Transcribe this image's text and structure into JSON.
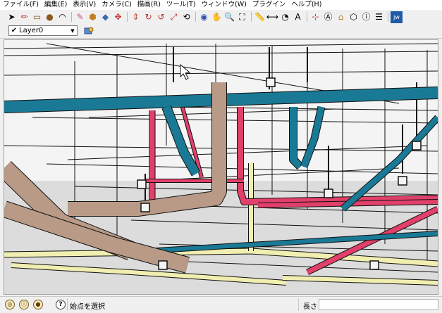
{
  "menu": [
    "ファイル(F)",
    "編集(E)",
    "表示(V)",
    "カメラ(C)",
    "描画(R)",
    "ツール(T)",
    "ウィンドウ(W)",
    "プラグイン",
    "ヘルプ(H)"
  ],
  "toolbar": {
    "icons": [
      "select-icon",
      "pencil-icon",
      "rectangle-icon",
      "circle-icon",
      "arc-icon",
      "eraser-icon",
      "paint-bucket-icon",
      "component-icon",
      "move-icon",
      "push-pull-icon",
      "rotate-icon",
      "follow-me-icon",
      "scale-icon",
      "offset-icon",
      "orbit-icon",
      "pan-icon",
      "zoom-icon",
      "zoom-extents-icon",
      "tape-measure-icon",
      "dimension-icon",
      "protractor-icon",
      "text-icon",
      "axes-icon",
      "3d-text-icon",
      "warehouse-icon",
      "extension-icon",
      "model-info-icon",
      "layer-icon",
      "plugin-icon"
    ],
    "glyphs": [
      "➤",
      "✏",
      "▭",
      "●",
      "◠",
      "✎",
      "⬢",
      "◆",
      "✥",
      "⇕",
      "↻",
      "↺",
      "⤢",
      "⟲",
      "◉",
      "✋",
      "🔍",
      "⛶",
      "📏",
      "⟷",
      "◔",
      "A",
      "⊹",
      "Ⓐ",
      "⌂",
      "⬡",
      "ⓘ",
      "☰",
      "jw"
    ],
    "accent": "#1e5aa8"
  },
  "layer": {
    "name": "Layer0",
    "check": "✔",
    "arrow": "▼"
  },
  "viewport": {
    "colors": {
      "teal": "#1a7a96",
      "teal_dark": "#0e5a72",
      "pink": "#e0406a",
      "tan": "#b89a86",
      "tan_dark": "#7a5a48",
      "cream": "#f0eeb0",
      "black": "#111111",
      "ground": "#dcdcdc",
      "sky": "#f4f4f4"
    }
  },
  "status": {
    "icons": [
      "geo-location-icon",
      "credits-icon",
      "user-account-icon"
    ],
    "help": "?",
    "text": "始点を選択",
    "length_label": "長さ",
    "length_value": ""
  }
}
